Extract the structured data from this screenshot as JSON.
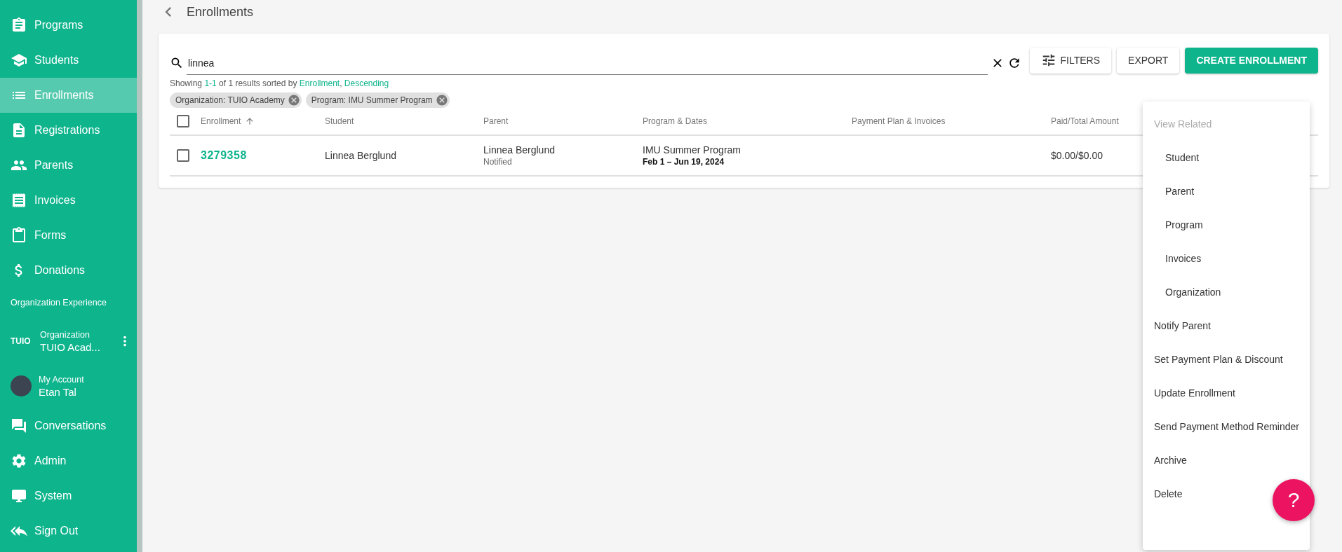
{
  "sidebar": {
    "items": [
      {
        "kind": "nav",
        "label": "Programs",
        "selected": false
      },
      {
        "kind": "nav",
        "label": "Students",
        "selected": false
      },
      {
        "kind": "nav",
        "label": "Enrollments",
        "selected": true
      },
      {
        "kind": "nav",
        "label": "Registrations",
        "selected": false
      },
      {
        "kind": "nav",
        "label": "Parents",
        "selected": false
      },
      {
        "kind": "nav",
        "label": "Invoices",
        "selected": false
      },
      {
        "kind": "nav",
        "label": "Forms",
        "selected": false
      },
      {
        "kind": "nav",
        "label": "Donations",
        "selected": false
      },
      {
        "kind": "section",
        "label": "Organization Experience"
      },
      {
        "kind": "org",
        "logo": "TUIO",
        "caption": "Organization",
        "label": "TUIO Acad..."
      },
      {
        "kind": "account",
        "caption": "My Account",
        "label": "Etan Tal"
      },
      {
        "kind": "nav",
        "label": "Conversations",
        "selected": false
      },
      {
        "kind": "nav",
        "label": "Admin",
        "selected": false
      },
      {
        "kind": "nav",
        "label": "System",
        "selected": false
      },
      {
        "kind": "nav",
        "label": "Sign Out",
        "selected": false
      }
    ]
  },
  "page": {
    "title": "Enrollments"
  },
  "search": {
    "value": "linnea"
  },
  "buttons": [
    {
      "kind": "outline",
      "label": "FILTERS"
    },
    {
      "kind": "outline",
      "label": "EXPORT"
    },
    {
      "kind": "primary",
      "label": "CREATE ENROLLMENT"
    }
  ],
  "summary": {
    "prefix": "Showing",
    "range": "1-1",
    "middle": "of 1 results sorted by",
    "sort_field": "Enrollment",
    "separator": ",",
    "sort_order": "Descending"
  },
  "chips": [
    "Organization: TUIO Academy",
    "Program: IMU Summer Program"
  ],
  "table": {
    "select_all_checked": false,
    "columns": [
      {
        "label": "Enrollment",
        "sorted": true
      },
      {
        "label": "Student",
        "sorted": false
      },
      {
        "label": "Parent",
        "sorted": false
      },
      {
        "label": "Program & Dates",
        "sorted": false
      },
      {
        "label": "Payment Plan & Invoices",
        "sorted": false
      },
      {
        "label": "Paid/Total Amount",
        "sorted": false
      }
    ],
    "rows": [
      {
        "checked": false,
        "enrollment": "3279358",
        "student": "Linnea Berglund",
        "parent": "Linnea Berglund",
        "parent_status": "Notified",
        "program": "IMU Summer Program",
        "dates": "Feb 1 – Jun 19, 2024",
        "amount": "$0.00/$0.00"
      }
    ]
  },
  "menu": [
    {
      "kind": "header",
      "label": "View Related"
    },
    {
      "kind": "sub",
      "label": "Student"
    },
    {
      "kind": "sub",
      "label": "Parent"
    },
    {
      "kind": "sub",
      "label": "Program"
    },
    {
      "kind": "sub",
      "label": "Invoices"
    },
    {
      "kind": "sub",
      "label": "Organization"
    },
    {
      "kind": "action",
      "label": "Notify Parent"
    },
    {
      "kind": "action",
      "label": "Set Payment Plan & Discount"
    },
    {
      "kind": "action",
      "label": "Update Enrollment"
    },
    {
      "kind": "action",
      "label": "Send Payment Method Reminder"
    },
    {
      "kind": "action",
      "label": "Archive"
    },
    {
      "kind": "action",
      "label": "Delete"
    }
  ],
  "help": {
    "label": "?"
  }
}
